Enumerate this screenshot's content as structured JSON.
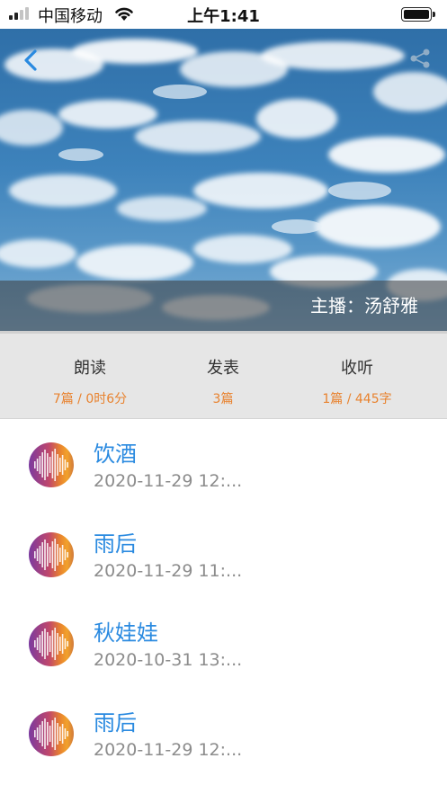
{
  "status_bar": {
    "carrier": "中国移动",
    "time": "上午1:41"
  },
  "header": {
    "back_icon": "chevron-left-icon",
    "share_icon": "share-icon",
    "host_label": "主播：汤舒雅"
  },
  "stats": [
    {
      "label": "朗读",
      "value": "7篇 / 0时6分"
    },
    {
      "label": "发表",
      "value": "3篇"
    },
    {
      "label": "收听",
      "value": "1篇 / 445字"
    }
  ],
  "recordings": [
    {
      "title": "饮酒",
      "date": "2020-11-29 12:..."
    },
    {
      "title": "雨后",
      "date": "2020-11-29 11:..."
    },
    {
      "title": "秋娃娃",
      "date": "2020-10-31 13:..."
    },
    {
      "title": "雨后",
      "date": "2020-11-29 12:..."
    }
  ],
  "colors": {
    "accent_blue": "#2a8ae0",
    "stat_orange": "#e8822e",
    "stats_bg": "#e6e6e6"
  }
}
